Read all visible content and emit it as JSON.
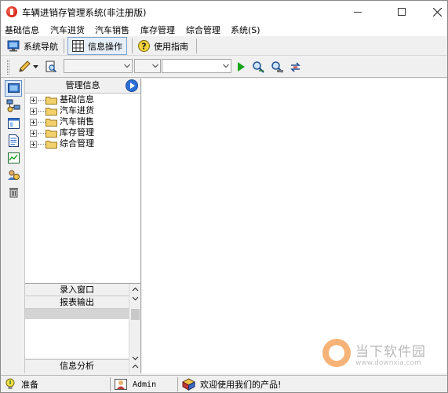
{
  "window": {
    "title": "车辆进销存管理系统(非注册版)"
  },
  "menu": {
    "items": [
      {
        "label": "基础信息"
      },
      {
        "label": "汽车进货"
      },
      {
        "label": "汽车销售"
      },
      {
        "label": "库存管理"
      },
      {
        "label": "综合管理"
      },
      {
        "label": "系统(S)"
      }
    ]
  },
  "tabs": [
    {
      "label": "系统导航",
      "icon": "monitor-icon"
    },
    {
      "label": "信息操作",
      "icon": "grid-table-icon",
      "active": true
    },
    {
      "label": "使用指南",
      "icon": "help-icon"
    }
  ],
  "toolbar": {
    "combo1_value": "",
    "combo2_value": "",
    "combo3_value": ""
  },
  "panel": {
    "header": "管理信息",
    "tree": [
      {
        "label": "基础信息"
      },
      {
        "label": "汽车进货"
      },
      {
        "label": "汽车销售"
      },
      {
        "label": "库存管理"
      },
      {
        "label": "综合管理"
      }
    ],
    "bottom": {
      "entry_window": "录入窗口",
      "report_output": "报表输出",
      "info_analysis": "信息分析"
    }
  },
  "status": {
    "ready": "准备",
    "user": "Admin",
    "welcome": "欢迎使用我们的产品!"
  },
  "watermark": {
    "name": "当下软件园",
    "url": "www.downxia.com"
  },
  "colors": {
    "accent": "#2d6fd6",
    "folder": "#f2d06b",
    "play": "#1aa31a"
  }
}
